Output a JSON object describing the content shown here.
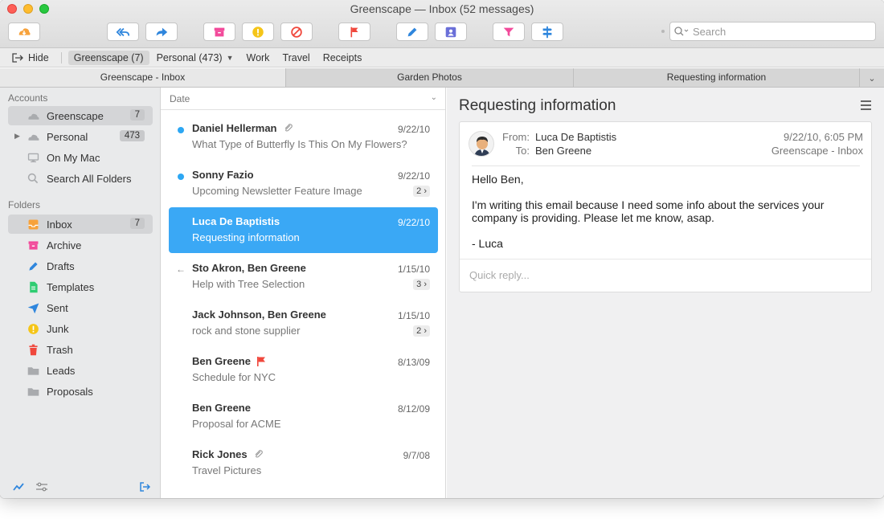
{
  "window": {
    "title": "Greenscape — Inbox (52 messages)"
  },
  "search": {
    "placeholder": "Search"
  },
  "toolbar": {
    "buttons": [
      "get-mail",
      "reply-all",
      "forward",
      "archive",
      "junk",
      "block",
      "flag",
      "compose",
      "contacts",
      "filter",
      "move"
    ]
  },
  "favorites": {
    "hide_label": "Hide",
    "items": [
      {
        "label": "Greenscape (7)",
        "active": true
      },
      {
        "label": "Personal (473)",
        "has_menu": true
      },
      {
        "label": "Work"
      },
      {
        "label": "Travel"
      },
      {
        "label": "Receipts"
      }
    ]
  },
  "tabs": [
    {
      "label": "Greenscape - Inbox",
      "active": true
    },
    {
      "label": "Garden Photos"
    },
    {
      "label": "Requesting information"
    }
  ],
  "sidebar": {
    "accounts_label": "Accounts",
    "folders_label": "Folders",
    "accounts": [
      {
        "label": "Greenscape",
        "badge": "7",
        "icon": "cloud-icon",
        "active": true
      },
      {
        "label": "Personal",
        "badge": "473",
        "icon": "cloud-icon",
        "expandable": true
      },
      {
        "label": "On My Mac",
        "icon": "computer-icon"
      },
      {
        "label": "Search All Folders",
        "icon": "search-icon"
      }
    ],
    "folders": [
      {
        "label": "Inbox",
        "badge": "7",
        "icon": "inbox-icon",
        "color": "#f7a23b",
        "active": true
      },
      {
        "label": "Archive",
        "icon": "archive-icon",
        "color": "#f24a9b"
      },
      {
        "label": "Drafts",
        "icon": "pencil-icon",
        "color": "#2f86dd"
      },
      {
        "label": "Templates",
        "icon": "document-icon",
        "color": "#2ecc71"
      },
      {
        "label": "Sent",
        "icon": "paper-plane-icon",
        "color": "#2f86dd"
      },
      {
        "label": "Junk",
        "icon": "warning-icon",
        "color": "#f5c518"
      },
      {
        "label": "Trash",
        "icon": "trash-icon",
        "color": "#f0473c"
      },
      {
        "label": "Leads",
        "icon": "folder-icon",
        "color": "#a9abae"
      },
      {
        "label": "Proposals",
        "icon": "folder-icon",
        "color": "#a9abae"
      }
    ]
  },
  "message_list": {
    "sort_label": "Date",
    "messages": [
      {
        "sender": "Daniel Hellerman",
        "subject": "What Type of Butterfly Is This On My Flowers?",
        "date": "9/22/10",
        "unread": true,
        "attachment": true
      },
      {
        "sender": "Sonny Fazio",
        "subject": "Upcoming Newsletter Feature Image",
        "date": "9/22/10",
        "unread": true,
        "count": "2 ›"
      },
      {
        "sender": "Luca De Baptistis",
        "subject": "Requesting information",
        "date": "9/22/10",
        "selected": true
      },
      {
        "sender": "Sto Akron, Ben Greene",
        "subject": "Help with Tree Selection",
        "date": "1/15/10",
        "replied": true,
        "count": "3 ›"
      },
      {
        "sender": "Jack Johnson, Ben Greene",
        "subject": "rock and stone supplier",
        "date": "1/15/10",
        "count": "2 ›"
      },
      {
        "sender": "Ben Greene",
        "subject": "Schedule for NYC",
        "date": "8/13/09",
        "flagged": true
      },
      {
        "sender": "Ben Greene",
        "subject": "Proposal for ACME",
        "date": "8/12/09"
      },
      {
        "sender": "Rick Jones",
        "subject": "Travel Pictures",
        "date": "9/7/08",
        "attachment": true
      }
    ]
  },
  "reader": {
    "title": "Requesting information",
    "from_label": "From:",
    "to_label": "To:",
    "from": "Luca De Baptistis",
    "to": "Ben Greene",
    "datetime": "9/22/10, 6:05 PM",
    "mailbox": "Greenscape - Inbox",
    "body": [
      "Hello Ben,",
      "I'm writing this email because I need some info about the services your",
      "company is providing. Please let me know, asap.",
      "- Luca"
    ],
    "quick_reply_placeholder": "Quick reply..."
  }
}
